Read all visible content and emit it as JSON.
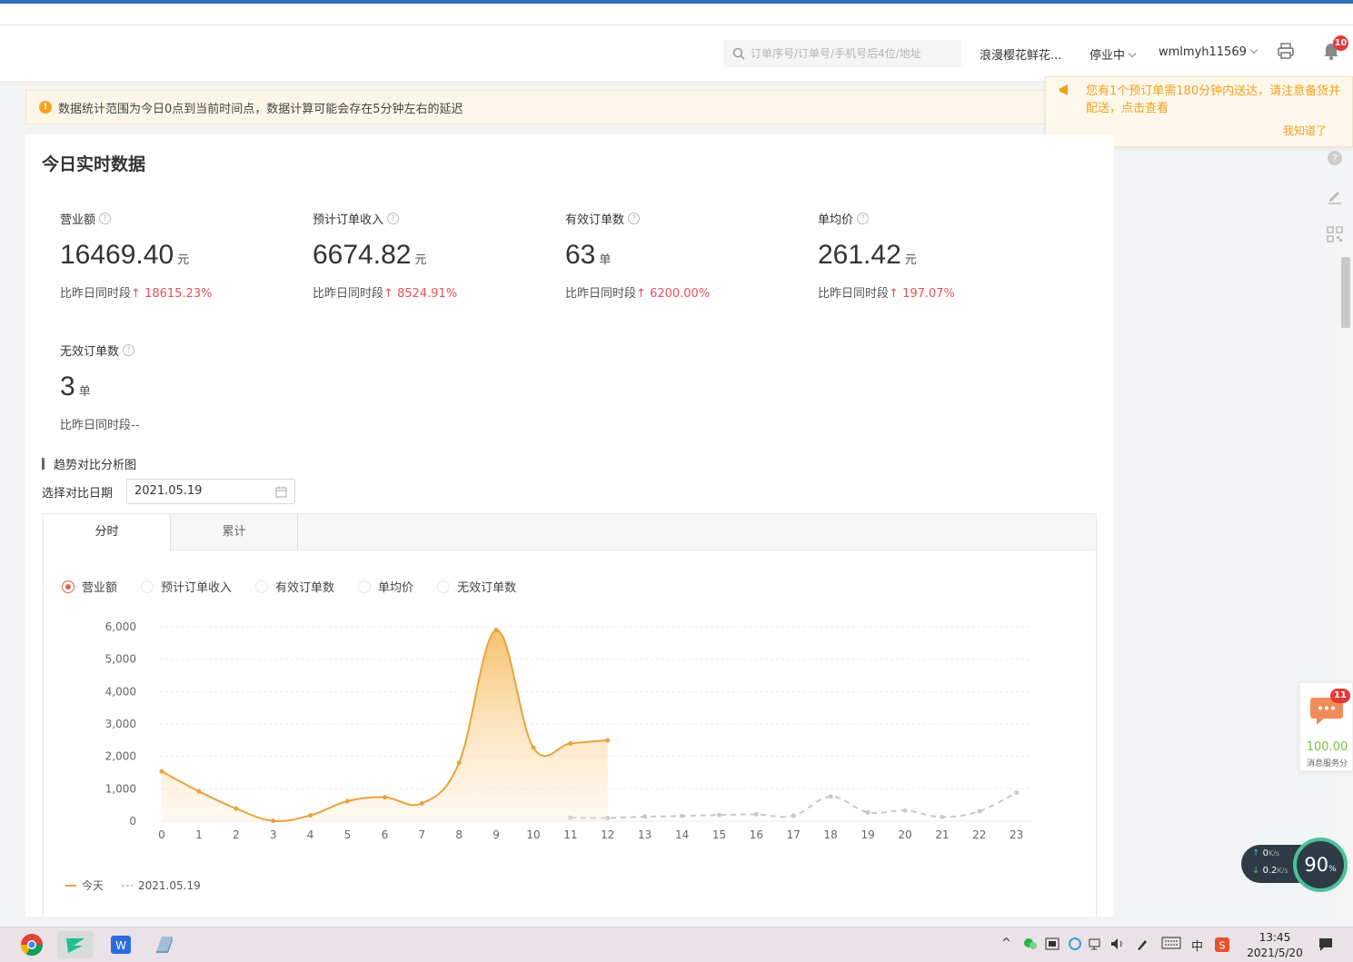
{
  "header": {
    "search_placeholder": "订单序号/订单号/手机号后4位/地址",
    "shop_name": "浪漫樱花鲜花...",
    "status": "停业中",
    "username": "wmlmyh11569",
    "bell_count": "10"
  },
  "notice": {
    "icon": "!",
    "text": "数据统计范围为今日0点到当前时间点，数据计算可能会存在5分钟左右的延迟"
  },
  "toast": {
    "message": "您有1个预订单需180分钟内送达，请注意备货并配送，点击查看",
    "ack": "我知道了"
  },
  "card": {
    "title": "今日实时数据"
  },
  "metrics": [
    {
      "label": "营业额",
      "value": "16469.40",
      "unit": "元",
      "compare_label": "比昨日同时段",
      "arrow": "↑",
      "compare_value": "18615.23%"
    },
    {
      "label": "预计订单收入",
      "value": "6674.82",
      "unit": "元",
      "compare_label": "比昨日同时段",
      "arrow": "↑",
      "compare_value": "8524.91%"
    },
    {
      "label": "有效订单数",
      "value": "63",
      "unit": "单",
      "compare_label": "比昨日同时段",
      "arrow": "↑",
      "compare_value": "6200.00%"
    },
    {
      "label": "单均价",
      "value": "261.42",
      "unit": "元",
      "compare_label": "比昨日同时段",
      "arrow": "↑",
      "compare_value": "197.07%"
    },
    {
      "label": "无效订单数",
      "value": "3",
      "unit": "单",
      "compare_label": "比昨日同时段--",
      "arrow": "",
      "compare_value": ""
    }
  ],
  "trend": {
    "title": "趋势对比分析图",
    "date_label": "选择对比日期",
    "date_value": "2021.05.19",
    "tabs": [
      "分时",
      "累计"
    ],
    "radios": [
      "营业额",
      "预计订单收入",
      "有效订单数",
      "单均价",
      "无效订单数"
    ]
  },
  "chart_data": {
    "type": "area",
    "x": [
      0,
      1,
      2,
      3,
      4,
      5,
      6,
      7,
      8,
      9,
      10,
      11,
      12,
      13,
      14,
      15,
      16,
      17,
      18,
      19,
      20,
      21,
      22,
      23
    ],
    "ylim": [
      0,
      6000
    ],
    "yticks": [
      "0",
      "1,000",
      "2,000",
      "3,000",
      "4,000",
      "5,000",
      "6,000"
    ],
    "series": [
      {
        "name": "今天",
        "color": "#e8a33d",
        "values": [
          1540,
          920,
          390,
          10,
          180,
          620,
          740,
          550,
          1800,
          5900,
          2270,
          2400,
          2500
        ]
      },
      {
        "name": "2021.05.19",
        "color": "#c8c8c8",
        "values": [
          null,
          null,
          null,
          null,
          null,
          null,
          null,
          null,
          null,
          null,
          null,
          110,
          100,
          140,
          160,
          190,
          210,
          170,
          760,
          270,
          330,
          130,
          310,
          880
        ]
      }
    ]
  },
  "service": {
    "badge": "11",
    "score": "100.00",
    "label": "消息服务分"
  },
  "network": {
    "up": "0",
    "up_unit": "K/s",
    "down": "0.2",
    "down_unit": "K/s",
    "percent": "90"
  },
  "taskbar": {
    "ime": "中",
    "time": "13:45",
    "date": "2021/5/20"
  }
}
